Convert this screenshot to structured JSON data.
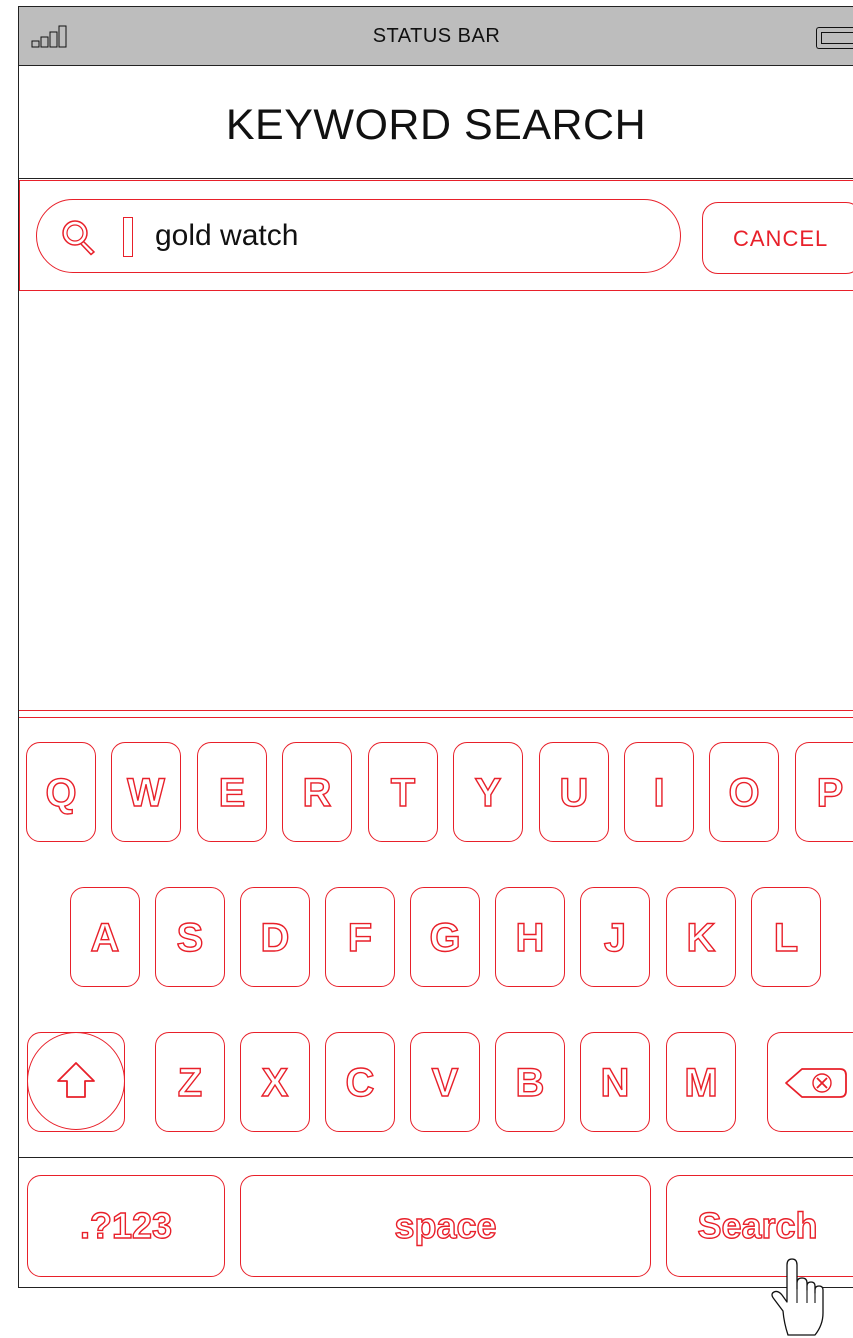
{
  "status_bar": {
    "title": "STATUS BAR"
  },
  "page": {
    "title": "KEYWORD SEARCH"
  },
  "search": {
    "query": "gold watch",
    "cancel_label": "CANCEL"
  },
  "keyboard": {
    "row1": [
      "Q",
      "W",
      "E",
      "R",
      "T",
      "Y",
      "U",
      "I",
      "O",
      "P"
    ],
    "row2": [
      "A",
      "S",
      "D",
      "F",
      "G",
      "H",
      "J",
      "K",
      "L"
    ],
    "row3": [
      "Z",
      "X",
      "C",
      "V",
      "B",
      "N",
      "M"
    ],
    "numbers_label": ".?123",
    "space_label": "space",
    "search_label": "Search"
  },
  "colors": {
    "accent": "#e8202a",
    "status_bar_bg": "#bdbdbd",
    "text": "#111111"
  },
  "icons": [
    "signal-icon",
    "battery-icon",
    "search-icon",
    "shift-icon",
    "backspace-icon",
    "pointer-hand-icon"
  ]
}
